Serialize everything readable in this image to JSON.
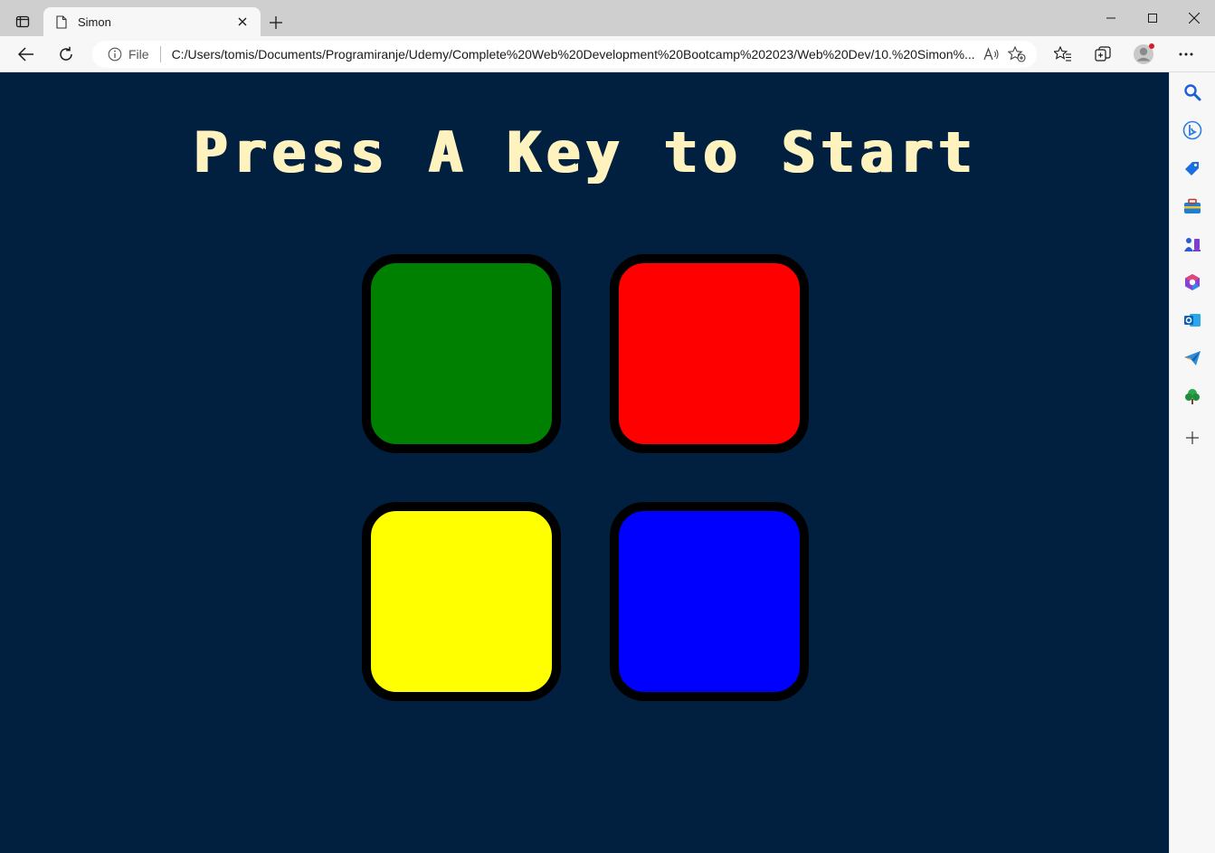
{
  "browser": {
    "tab": {
      "title": "Simon"
    },
    "address": {
      "scheme": "File",
      "url": "C:/Users/tomis/Documents/Programiranje/Udemy/Complete%20Web%20Development%20Bootcamp%202023/Web%20Dev/10.%20Simon%..."
    }
  },
  "page": {
    "title": "Press A Key to Start",
    "background": "#011F3F",
    "title_color": "#FEF2BF",
    "buttons": [
      {
        "id": "green",
        "color": "#008000"
      },
      {
        "id": "red",
        "color": "#FF0000"
      },
      {
        "id": "yellow",
        "color": "#FFFF00"
      },
      {
        "id": "blue",
        "color": "#0000FF"
      }
    ]
  },
  "sidebar": {
    "items": [
      "search-icon",
      "bing-icon",
      "shopping-icon",
      "tools-icon",
      "games-icon",
      "microsoft365-icon",
      "outlook-icon",
      "telegram-icon",
      "tree-icon",
      "add-icon"
    ]
  }
}
